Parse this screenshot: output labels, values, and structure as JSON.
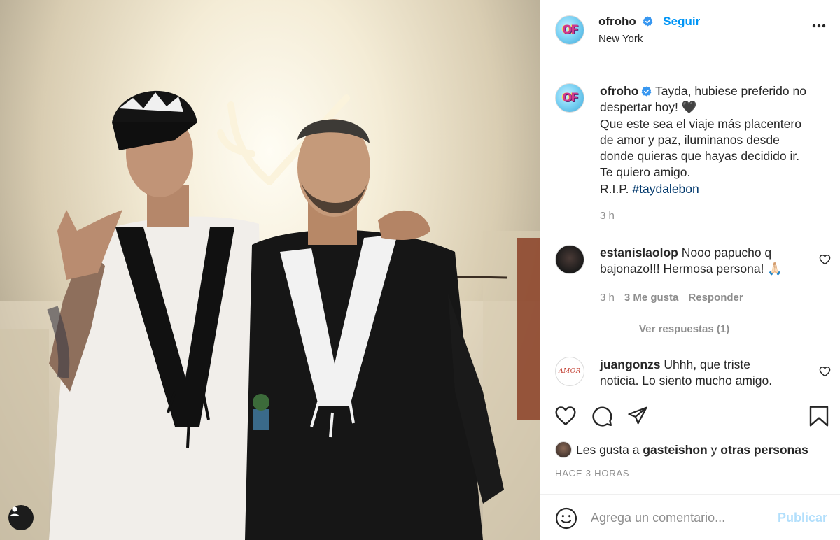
{
  "post": {
    "username": "ofroho",
    "follow_label": "Seguir",
    "location": "New York",
    "avatar_text": "OF"
  },
  "caption": {
    "username": "ofroho",
    "lines": [
      "Tayda, hubiese preferido no",
      "despertar hoy! 🖤",
      "Que este sea el viaje más placentero",
      "de amor y paz, iluminanos desde",
      "donde quieras que hayas decidido ir.",
      "Te quiero amigo.",
      "R.I.P."
    ],
    "hashtag": "#taydalebon",
    "time": "3 h"
  },
  "comments": [
    {
      "username": "estanislaolop",
      "text_line1": "Nooo papucho q",
      "text_line2": "bajonazo!!! Hermosa persona! 🙏🏻",
      "time": "3 h",
      "likes": "3 Me gusta",
      "reply": "Responder"
    },
    {
      "username": "juangonzs",
      "avatar_text": "AMOR",
      "text_line1": "Uhhh, que triste",
      "text_line2": "noticia. Lo siento mucho amigo."
    }
  ],
  "view_replies": "Ver respuestas (1)",
  "likes_summary": {
    "prefix": "Les gusta a",
    "user": "gasteishon",
    "connector": "y",
    "others": "otras personas"
  },
  "time_ago": "HACE 3 HORAS",
  "add_comment": {
    "placeholder": "Agrega un comentario...",
    "publish_label": "Publicar"
  },
  "colors": {
    "accent": "#0095f6",
    "hashtag": "#00376b",
    "muted": "#8e8e8e",
    "publish_disabled": "#b2dffc"
  },
  "icons": [
    "more-options-icon",
    "verified-badge-icon",
    "heart-icon",
    "comment-icon",
    "share-icon",
    "bookmark-icon",
    "emoji-icon",
    "user-tag-icon"
  ]
}
